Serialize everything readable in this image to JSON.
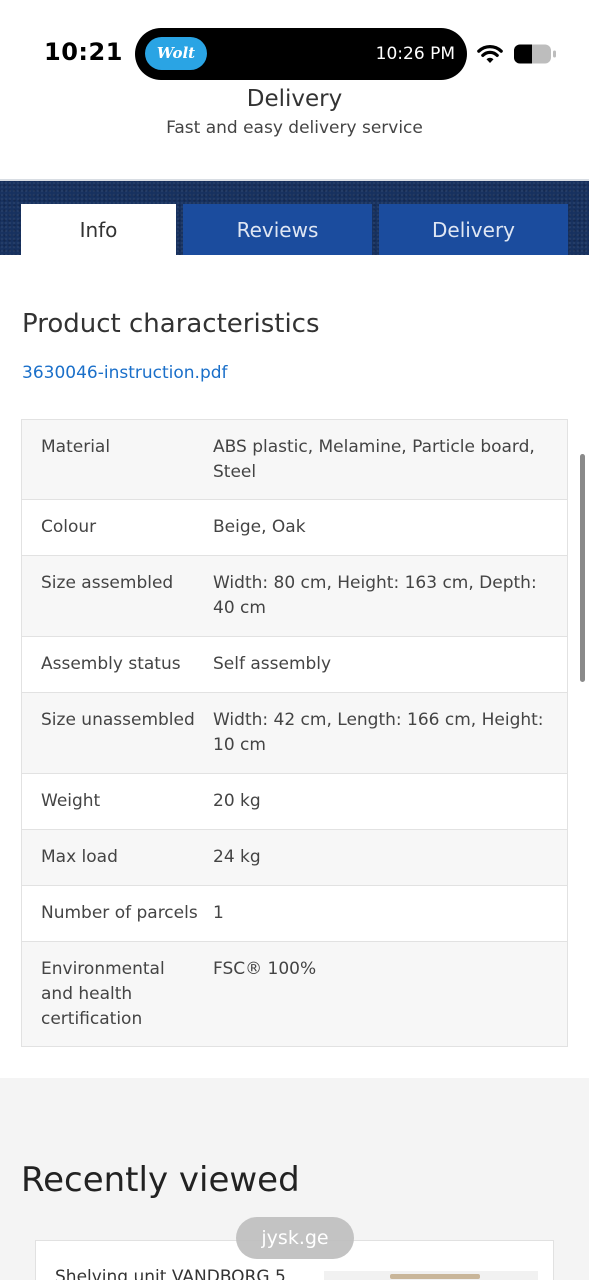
{
  "status_bar": {
    "time": "10:21",
    "island_app": "Wolt",
    "island_time": "10:26 PM"
  },
  "header": {
    "title": "Delivery",
    "subtitle": "Fast and easy delivery service"
  },
  "tabs": [
    {
      "label": "Info",
      "active": true
    },
    {
      "label": "Reviews",
      "active": false
    },
    {
      "label": "Delivery",
      "active": false
    }
  ],
  "product": {
    "section_title": "Product characteristics",
    "pdf_link": "3630046-instruction.pdf",
    "specs": [
      {
        "label": "Material",
        "value": "ABS plastic, Melamine, Particle board, Steel"
      },
      {
        "label": "Colour",
        "value": "Beige, Oak"
      },
      {
        "label": "Size assembled",
        "value": "Width: 80 cm, Height: 163 cm, Depth: 40 cm"
      },
      {
        "label": "Assembly status",
        "value": "Self assembly"
      },
      {
        "label": "Size unassembled",
        "value": "Width: 42 cm, Length: 166 cm, Height: 10 cm"
      },
      {
        "label": "Weight",
        "value": "20 kg"
      },
      {
        "label": "Max load",
        "value": "24 kg"
      },
      {
        "label": "Number of parcels",
        "value": "1"
      },
      {
        "label": "Environmental and health certification",
        "value": "FSC® 100%"
      }
    ]
  },
  "recently_viewed": {
    "title": "Recently viewed",
    "card_title": "Shelving unit VANDBORG 5"
  },
  "browser": {
    "url": "jysk.ge"
  },
  "colors": {
    "tab_active_bg": "#ffffff",
    "tab_inactive_bg": "#1b4c9e",
    "band_bg": "#17315f",
    "link": "#1a6fc9",
    "wolt_brand": "#2aa4e4"
  },
  "icons": [
    "wifi-icon",
    "battery-icon"
  ]
}
